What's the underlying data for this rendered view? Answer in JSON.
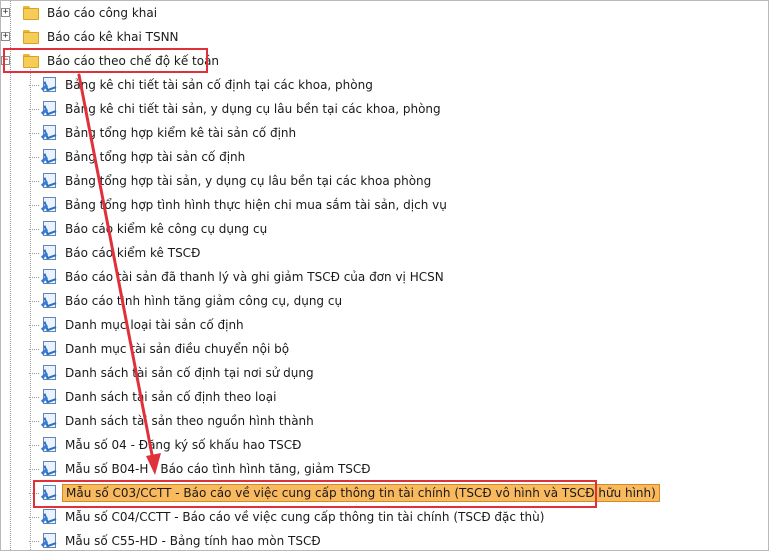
{
  "tree": {
    "folders": [
      {
        "label": "Báo cáo công khai",
        "expander": "+"
      },
      {
        "label": "Báo cáo kê khai TSNN",
        "expander": "+"
      },
      {
        "label": "Báo cáo theo chế độ kế toán",
        "expander": "−"
      }
    ],
    "reports": [
      {
        "label": "Bảng kê chi tiết tài sản cố định tại các khoa, phòng"
      },
      {
        "label": "Bảng kê chi tiết tài sản, y dụng cụ lâu bền tại các khoa, phòng"
      },
      {
        "label": "Bảng tổng hợp kiểm kê tài sản cố định"
      },
      {
        "label": "Bảng tổng hợp tài sản cố định"
      },
      {
        "label": "Bảng tổng hợp tài sản, y dụng cụ lâu bền tại các khoa phòng"
      },
      {
        "label": "Bảng tổng hợp tình hình thực hiện chi mua sắm tài sản, dịch vụ"
      },
      {
        "label": "Báo cáo kiểm kê công cụ dụng cụ"
      },
      {
        "label": "Báo cáo kiểm kê TSCĐ"
      },
      {
        "label": "Báo cáo tài sản đã thanh lý và ghi giảm TSCĐ của đơn vị HCSN"
      },
      {
        "label": "Báo cáo tình hình tăng giảm công cụ, dụng cụ"
      },
      {
        "label": "Danh mục loại tài sản cố định"
      },
      {
        "label": "Danh mục tài sản điều chuyển nội bộ"
      },
      {
        "label": "Danh sách tài sản cố định tại nơi sử dụng"
      },
      {
        "label": "Danh sách tài sản cố định theo loại"
      },
      {
        "label": "Danh sách tài sản theo nguồn hình thành"
      },
      {
        "label": "Mẫu số 04 - Đăng ký số khấu hao TSCĐ"
      },
      {
        "label": "Mẫu số B04-H - Báo cáo tình hình tăng, giảm TSCĐ"
      },
      {
        "label": "Mẫu số C03/CCTT - Báo cáo về việc cung cấp thông tin tài chính (TSCĐ vô hình và TSCĐ hữu hình)",
        "selected": true
      },
      {
        "label": "Mẫu số C04/CCTT - Báo cáo về việc cung cấp thông tin tài chính (TSCĐ đặc thù)"
      },
      {
        "label": "Mẫu số C55-HD - Bảng tính hao mòn TSCĐ"
      }
    ]
  },
  "colors": {
    "highlight": "#e0313a",
    "selection": "#f8b95f"
  }
}
